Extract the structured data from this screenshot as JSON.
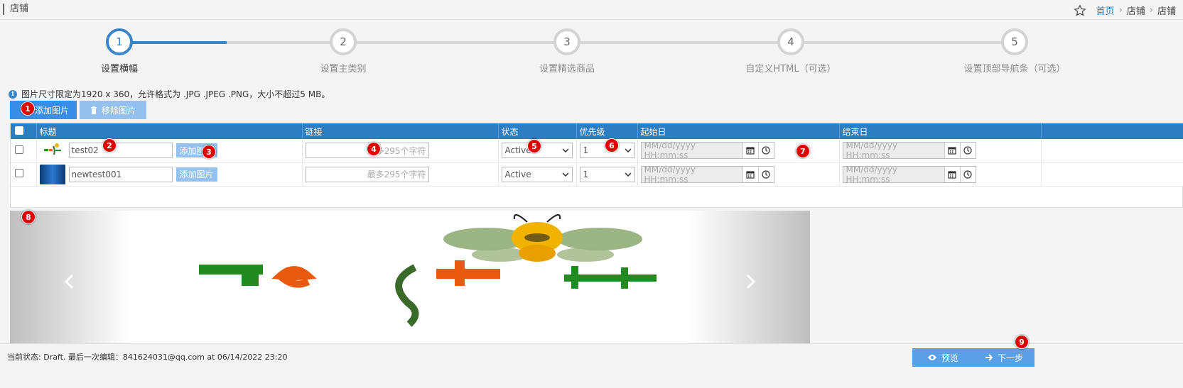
{
  "header": {
    "title": "店铺",
    "breadcrumbs": [
      "首页",
      "店铺",
      "店铺"
    ],
    "breadcrumb_sep": "›"
  },
  "stepper": {
    "current_progress": 0.12,
    "steps": [
      {
        "number": "1",
        "label": "设置横幅"
      },
      {
        "number": "2",
        "label": "设置主类别"
      },
      {
        "number": "3",
        "label": "设置精选商品"
      },
      {
        "number": "4",
        "label": "自定义HTML（可选）"
      },
      {
        "number": "5",
        "label": "设置顶部导航条（可选）"
      }
    ]
  },
  "info_text": "图片尺寸限定为1920 x 360，允许格式为 .JPG .JPEG .PNG，大小不超过5 MB。",
  "actions": {
    "add_label": "添加图片",
    "remove_label": "移除图片"
  },
  "table": {
    "columns": [
      "标题",
      "链接",
      "状态",
      "优先级",
      "起始日",
      "结束日"
    ],
    "rows": [
      {
        "title": "test02",
        "add_image": "添加图片",
        "link_placeholder": "最多295个字符",
        "status": "Active",
        "priority": "1",
        "start_placeholder": "MM/dd/yyyy HH:mm:ss",
        "end_placeholder": "MM/dd/yyyy HH:mm:ss"
      },
      {
        "title": "newtest001",
        "add_image": "添加图片",
        "link_placeholder": "最多295个字符",
        "status": "Active",
        "priority": "1",
        "start_placeholder": "MM/dd/yyyy HH:mm:ss",
        "end_placeholder": "MM/dd/yyyy HH:mm:ss"
      }
    ]
  },
  "markers": [
    "1",
    "2",
    "3",
    "4",
    "5",
    "6",
    "7",
    "8",
    "9"
  ],
  "carousel": {
    "icons": [
      "chevron-left-icon",
      "chevron-right-icon"
    ]
  },
  "footer": {
    "status": "当前状态: Draft. 最后一次编辑：841624031@qq.com at 06/14/2022 23:20",
    "preview_label": "预览",
    "next_label": "下一步"
  },
  "colors": {
    "primary": "#2e7cc1",
    "button": "#3a8ee6",
    "button_light": "#94c1ee",
    "marker": "#e00000"
  }
}
